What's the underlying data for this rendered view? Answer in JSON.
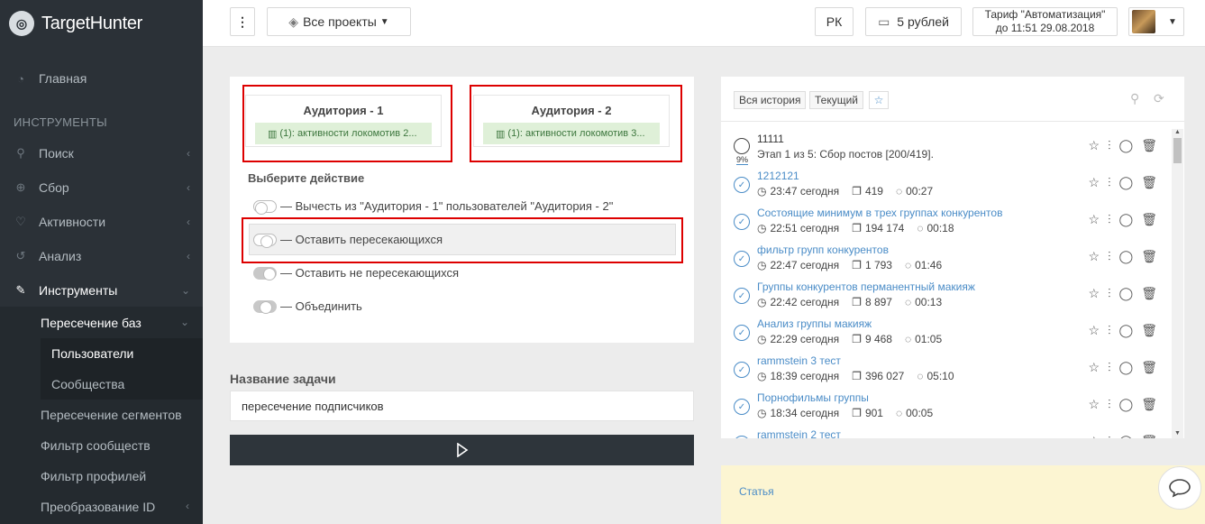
{
  "sidebar": {
    "brand": "TargetHunter",
    "section_title": "ИНСТРУМЕНТЫ",
    "items": [
      {
        "label": "Главная"
      },
      {
        "label": "Поиск"
      },
      {
        "label": "Сбор"
      },
      {
        "label": "Активности"
      },
      {
        "label": "Анализ"
      },
      {
        "label": "Инструменты"
      }
    ],
    "sub": {
      "group": "Пересечение баз",
      "group_items": [
        "Пользователи",
        "Сообщества"
      ],
      "more": [
        "Пересечение сегментов",
        "Фильтр сообществ",
        "Фильтр профилей",
        "Преобразование ID"
      ]
    }
  },
  "topbar": {
    "menu_icon": "⋮",
    "projects_label": "Все проекты",
    "rk_label": "РК",
    "balance_label": "5 рублей",
    "tariff_line1": "Тариф \"Автоматизация\"",
    "tariff_line2": "до 11:51 29.08.2018"
  },
  "main": {
    "audience1": {
      "title": "Аудитория - 1",
      "tag": "(1): активности локомотив 2..."
    },
    "audience2": {
      "title": "Аудитория - 2",
      "tag": "(1): активности локомотив 3..."
    },
    "choose_label": "Выберите действие",
    "options": [
      "— Вычесть из \"Аудитория - 1\" пользователей \"Аудитория - 2\"",
      "— Оставить пересекающихся",
      "— Оставить не пересекающихся",
      "— Объединить"
    ],
    "task_label": "Название задачи",
    "task_value": "пересечение подписчиков"
  },
  "history": {
    "tab_all": "Вся история",
    "tab_current": "Текущий",
    "first": {
      "title": "11111",
      "sub": "Этап 1 из 5: Сбор постов [200/419].",
      "percent": "9%"
    },
    "rows": [
      {
        "title": "1212121",
        "time": "23:47 сегодня",
        "count": "419",
        "dur": "00:27"
      },
      {
        "title": "Состоящие минимум в трех группах конкурентов",
        "time": "22:51 сегодня",
        "count": "194 174",
        "dur": "00:18"
      },
      {
        "title": "фильтр групп конкурентов",
        "time": "22:47 сегодня",
        "count": "1 793",
        "dur": "01:46"
      },
      {
        "title": "Группы конкурентов перманентный макияж",
        "time": "22:42 сегодня",
        "count": "8 897",
        "dur": "00:13"
      },
      {
        "title": "Анализ группы макияж",
        "time": "22:29 сегодня",
        "count": "9 468",
        "dur": "01:05"
      },
      {
        "title": "rammstein 3 тест",
        "time": "18:39 сегодня",
        "count": "396 027",
        "dur": "05:10"
      },
      {
        "title": "Порнофильмы группы",
        "time": "18:34 сегодня",
        "count": "901",
        "dur": "00:05"
      },
      {
        "title": "rammstein 2 тест",
        "time": "",
        "count": "",
        "dur": ""
      }
    ]
  },
  "article": {
    "label": "Статья"
  }
}
